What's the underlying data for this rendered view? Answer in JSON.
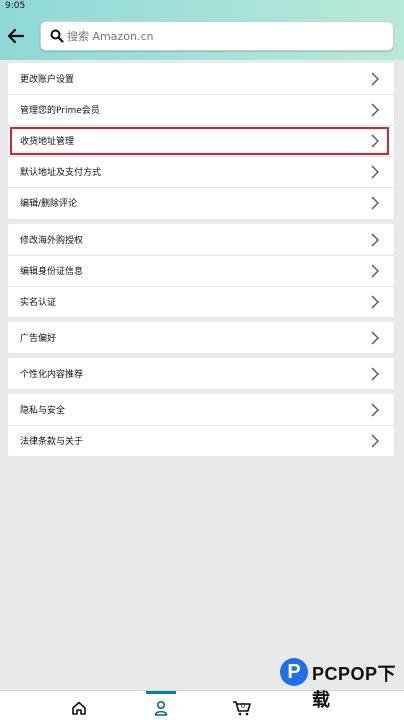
{
  "status_bar": {
    "time": "9:05"
  },
  "search": {
    "placeholder": "搜索 Amazon.cn"
  },
  "groups": [
    {
      "items": [
        {
          "label": "更改账户设置"
        },
        {
          "label": "管理您的Prime会员"
        },
        {
          "label": "收货地址管理",
          "highlighted": true
        },
        {
          "label": "默认地址及支付方式"
        },
        {
          "label": "编辑/删除评论"
        }
      ]
    },
    {
      "items": [
        {
          "label": "修改海外购授权"
        },
        {
          "label": "编辑身份证信息"
        },
        {
          "label": "实名认证"
        }
      ]
    },
    {
      "items": [
        {
          "label": "广告偏好"
        }
      ]
    },
    {
      "items": [
        {
          "label": "个性化内容推荐"
        }
      ]
    },
    {
      "items": [
        {
          "label": "隐私与安全"
        },
        {
          "label": "法律条款与关于"
        }
      ]
    }
  ],
  "bottom_nav": {
    "active": "account",
    "icons": [
      "home-icon",
      "account-icon",
      "cart-icon"
    ],
    "cart_count": "0"
  },
  "watermark": {
    "logo_letter": "P",
    "text": "PCPOP下载"
  },
  "colors": {
    "header_gradient_start": "#8fd8d6",
    "header_gradient_end": "#b9e9d7",
    "highlight_border": "#d6232f",
    "nav_indicator": "#008296",
    "watermark_blue": "#1f6fe8"
  }
}
